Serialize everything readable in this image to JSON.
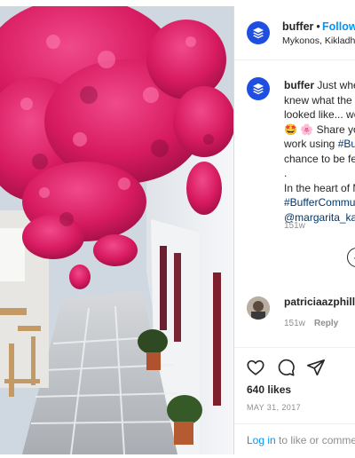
{
  "header": {
    "username": "buffer",
    "dot": "•",
    "follow_label": "Follow",
    "location": "Mykonos, Kikladhe"
  },
  "caption": {
    "username": "buffer",
    "lines": [
      "Just whe",
      "knew what the p",
      "looked like... we",
      "Share yo",
      "work using ",
      "chance to be fe",
      ".",
      "In the heart of M"
    ],
    "hashtag_1": "#Bu",
    "hashtag_2": "#BufferCommu",
    "mention": "@margarita_ka",
    "emoji_1": "🤩",
    "emoji_2": "🌸",
    "time": "151w"
  },
  "more_comments_symbol": "+",
  "comment": {
    "username": "patriciaazphillip",
    "time": "151w",
    "reply_label": "Reply"
  },
  "actions": {
    "likes": "640 likes",
    "date": "MAY 31, 2017",
    "icons": [
      "heart-icon",
      "comment-icon",
      "share-icon"
    ]
  },
  "login": {
    "link_label": "Log in",
    "rest": " to like or comme"
  },
  "colors": {
    "brand_blue": "#1f4fe0",
    "link_blue": "#0095f6",
    "hashtag": "#00376b",
    "flowers": "#d81b60"
  }
}
